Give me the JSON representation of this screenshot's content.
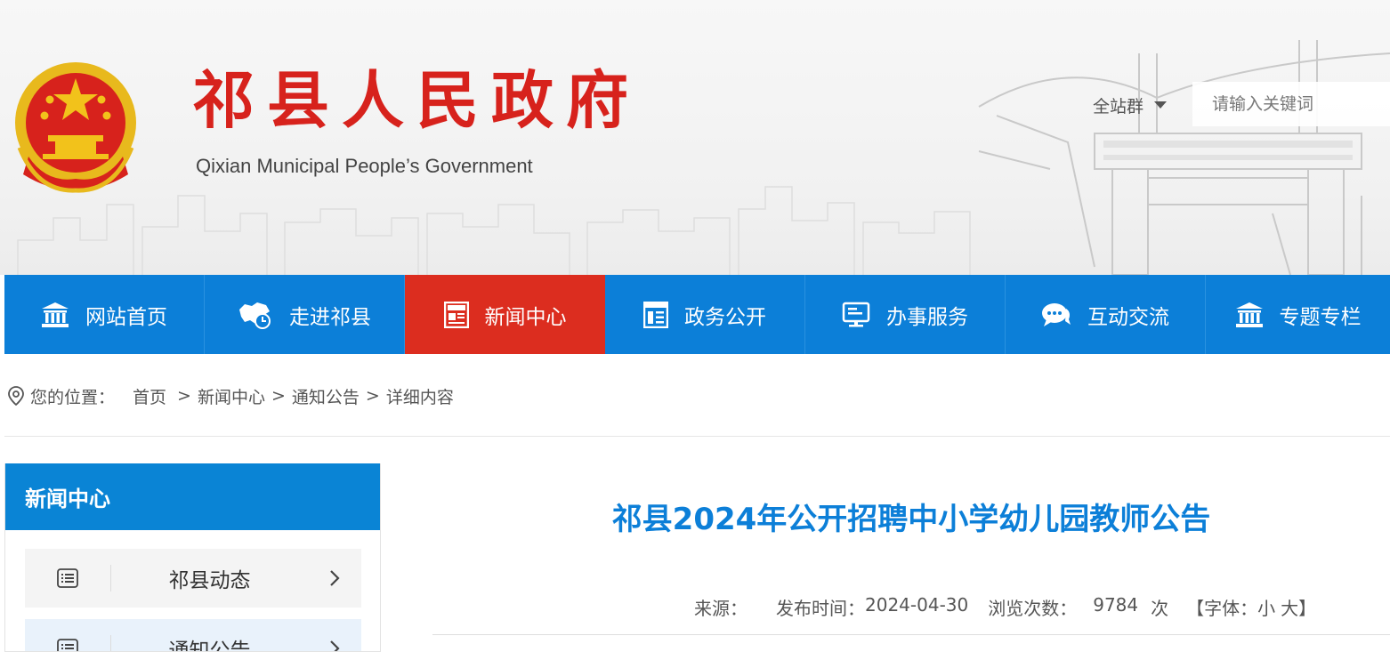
{
  "header": {
    "title_cn": "祁县人民政府",
    "title_en": "Qixian Municipal People’s Government",
    "site_group_label": "全站群",
    "search_placeholder": "请输入关键词",
    "emblem_icon": "national-emblem-icon",
    "brand_red": "#d7221c"
  },
  "nav": {
    "items": [
      {
        "label": "网站首页",
        "icon": "institution-icon"
      },
      {
        "label": "走进祁县",
        "icon": "map-clock-icon"
      },
      {
        "label": "新闻中心",
        "icon": "newspaper-icon"
      },
      {
        "label": "政务公开",
        "icon": "document-panel-icon"
      },
      {
        "label": "办事服务",
        "icon": "monitor-icon"
      },
      {
        "label": "互动交流",
        "icon": "chat-bubbles-icon"
      },
      {
        "label": "专题专栏",
        "icon": "institution-icon"
      }
    ],
    "active_index": 2,
    "bg_color": "#0c7fd8",
    "active_color": "#dc2d1f"
  },
  "breadcrumb": {
    "prefix": "您的位置：",
    "items": [
      "首页",
      "新闻中心",
      "通知公告",
      "详细内容"
    ],
    "separator": ">"
  },
  "sidebar": {
    "title": "新闻中心",
    "items": [
      {
        "label": "祁县动态"
      },
      {
        "label": "通知公告"
      }
    ]
  },
  "article": {
    "title": "祁县2024年公开招聘中小学幼儿园教师公告",
    "source_label": "来源：",
    "source_value": "",
    "publish_label": "发布时间：",
    "publish_date": "2024-04-30",
    "views_label": "浏览次数：",
    "views_count": "9784",
    "views_unit": "次",
    "font_label": "【字体：",
    "font_small": "小",
    "font_large": "大",
    "font_close": "】"
  }
}
